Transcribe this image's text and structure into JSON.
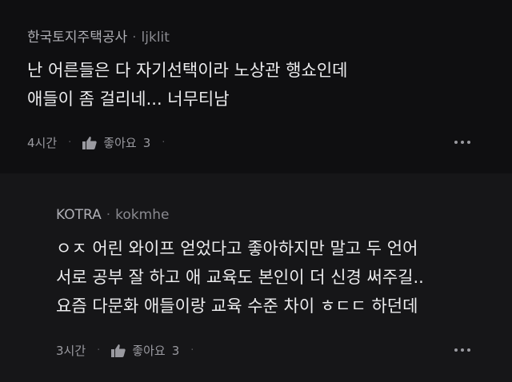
{
  "comments": [
    {
      "author": "한국토지주택공사",
      "handle": "ljklit",
      "lines": [
        "난 어른들은 다 자기선택이라 노상관 행쇼인데",
        "애들이 좀 걸리네... 너무티남"
      ],
      "time": "4시간",
      "like_label": "좋아요",
      "like_count": "3",
      "more_icon": "more-horizontal-icon",
      "like_icon": "thumbs-up-icon"
    },
    {
      "author": "KOTRA",
      "handle": "kokmhe",
      "lines": [
        "ㅇㅈ 어린 와이프 얻었다고 좋아하지만 말고 두 언어",
        "서로 공부 잘 하고 애 교육도 본인이 더 신경 써주길..",
        "요즘 다문화 애들이랑 교육 수준 차이 ㅎㄷㄷ 하던데"
      ],
      "time": "3시간",
      "like_label": "좋아요",
      "like_count": "3",
      "more_icon": "more-horizontal-icon",
      "like_icon": "thumbs-up-icon"
    }
  ],
  "colors": {
    "background": "#0f0f11",
    "reply_background": "#161618",
    "text": "#ececee",
    "muted": "#9a9aa0"
  }
}
